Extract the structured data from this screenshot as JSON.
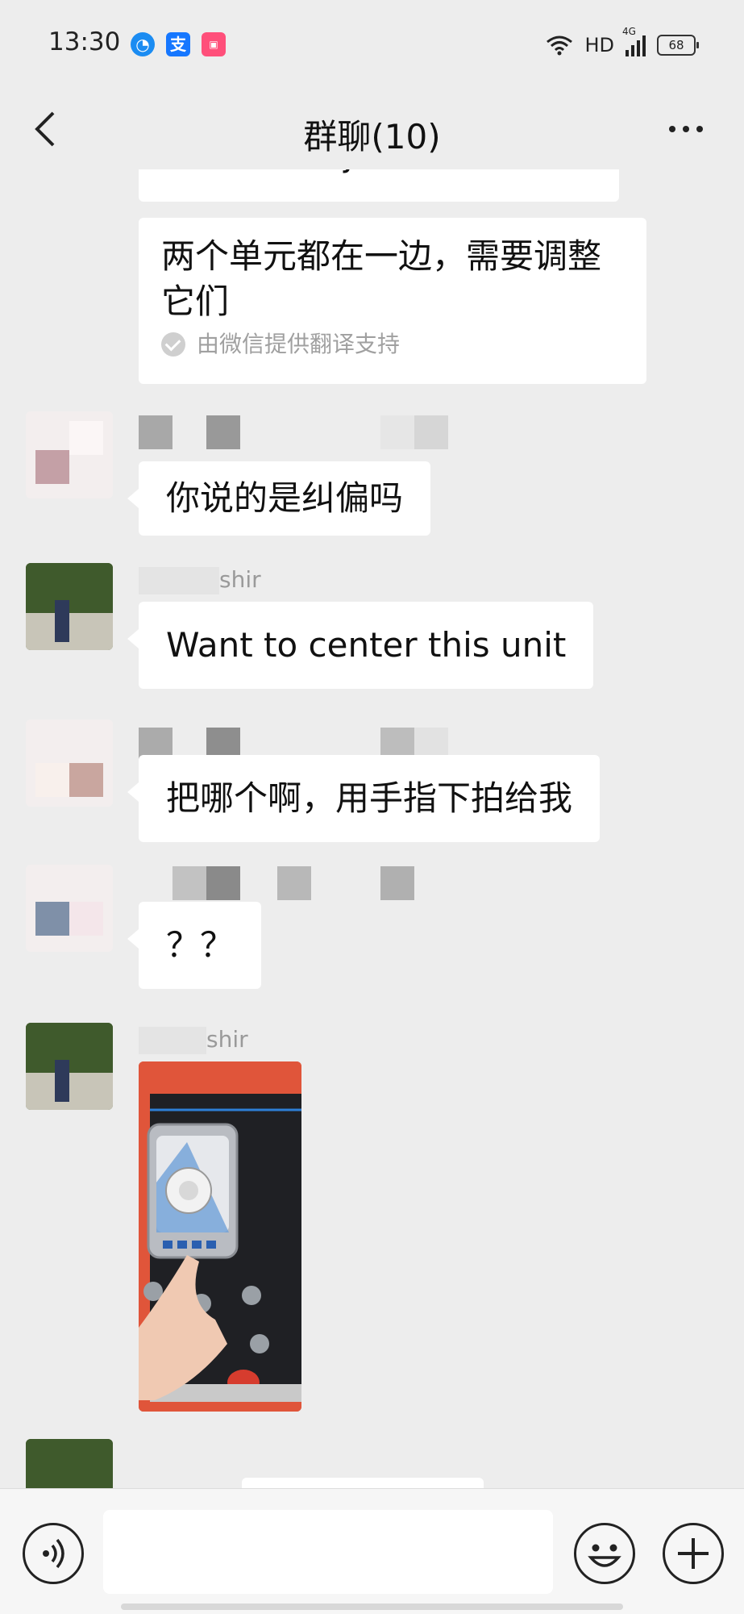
{
  "status_bar": {
    "time": "13:30",
    "network": "HD",
    "signal": "4G",
    "battery": "68",
    "app_icons": [
      "qq-browser-icon",
      "alipay-icon",
      "pinduoduo-icon"
    ]
  },
  "nav": {
    "title": "群聊(10)"
  },
  "messages": [
    {
      "type": "text",
      "text": "need to adjust them",
      "clipped": true
    },
    {
      "type": "translation",
      "text": "两个单元都在一边，需要调整它们",
      "note": "由微信提供翻译支持"
    },
    {
      "type": "text",
      "sender": "",
      "text": "你说的是纠偏吗"
    },
    {
      "type": "text",
      "sender": "shir",
      "text": "Want to center this unit"
    },
    {
      "type": "text",
      "sender": "",
      "text": "把哪个啊，用手指下拍给我"
    },
    {
      "type": "text",
      "sender": "",
      "text": "？？"
    },
    {
      "type": "image",
      "sender": "shir",
      "image_label": "control-panel-photo"
    },
    {
      "type": "text",
      "sender": "shir",
      "text": "",
      "clipped": true
    }
  ],
  "input": {
    "value": "",
    "placeholder": ""
  },
  "colors": {
    "background": "#ededed",
    "bubble": "#ffffff",
    "text": "#111111",
    "sender_name": "#9a9a9a"
  }
}
